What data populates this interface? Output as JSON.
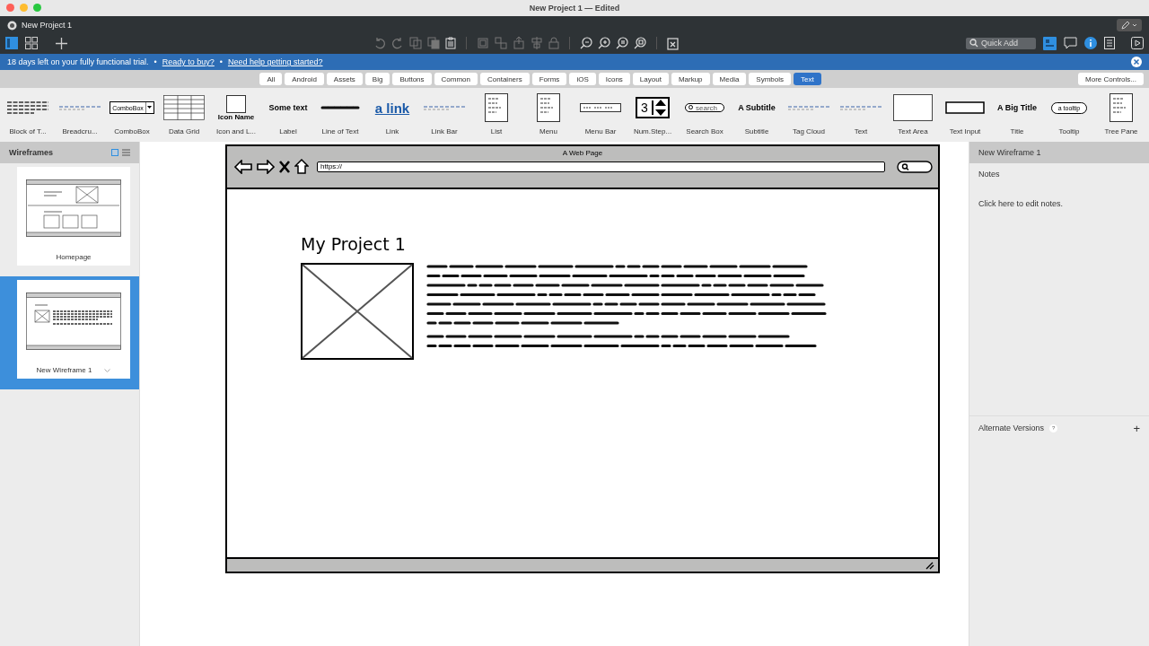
{
  "window": {
    "title": "New Project 1 — Edited"
  },
  "toolbar": {
    "project": "New Project 1",
    "quick_add": {
      "placeholder": "Quick Add"
    }
  },
  "trial_bar": {
    "message": "18 days left on your fully functional trial.",
    "separator": "•",
    "links": [
      "Ready to buy?",
      "Need help getting started?"
    ]
  },
  "filters": [
    {
      "label": "All",
      "selected": false
    },
    {
      "label": "Android",
      "selected": false
    },
    {
      "label": "Assets",
      "selected": false
    },
    {
      "label": "Big",
      "selected": false
    },
    {
      "label": "Buttons",
      "selected": false
    },
    {
      "label": "Common",
      "selected": false
    },
    {
      "label": "Containers",
      "selected": false
    },
    {
      "label": "Forms",
      "selected": false
    },
    {
      "label": "iOS",
      "selected": false
    },
    {
      "label": "Icons",
      "selected": false
    },
    {
      "label": "Layout",
      "selected": false
    },
    {
      "label": "Markup",
      "selected": false
    },
    {
      "label": "Media",
      "selected": false
    },
    {
      "label": "Symbols",
      "selected": false
    },
    {
      "label": "Text",
      "selected": true
    }
  ],
  "more_controls": "More Controls...",
  "library": [
    {
      "label": "Block of T...",
      "kind": "lines"
    },
    {
      "label": "Breadcru...",
      "kind": "thin"
    },
    {
      "label": "ComboBox",
      "kind": "combo",
      "preview": "ComboBox"
    },
    {
      "label": "Data Grid",
      "kind": "grid"
    },
    {
      "label": "Icon and L...",
      "kind": "icon",
      "preview": "Icon Name"
    },
    {
      "label": "Label",
      "kind": "label",
      "preview": "Some text"
    },
    {
      "label": "Line of Text",
      "kind": "scribble"
    },
    {
      "label": "Link",
      "kind": "link",
      "preview": "a link"
    },
    {
      "label": "Link Bar",
      "kind": "thin"
    },
    {
      "label": "List",
      "kind": "list"
    },
    {
      "label": "Menu",
      "kind": "list"
    },
    {
      "label": "Menu Bar",
      "kind": "menubar"
    },
    {
      "label": "Num.Step...",
      "kind": "stepper",
      "preview": "3"
    },
    {
      "label": "Search Box",
      "kind": "search",
      "preview": "search"
    },
    {
      "label": "Subtitle",
      "kind": "label",
      "preview": "A Subtitle"
    },
    {
      "label": "Tag Cloud",
      "kind": "thin"
    },
    {
      "label": "Text",
      "kind": "thin"
    },
    {
      "label": "Text Area",
      "kind": "box"
    },
    {
      "label": "Text Input",
      "kind": "input"
    },
    {
      "label": "Title",
      "kind": "label",
      "preview": "A Big Title"
    },
    {
      "label": "Tooltip",
      "kind": "tooltip",
      "preview": "a tooltip"
    },
    {
      "label": "Tree Pane",
      "kind": "list"
    }
  ],
  "sidebar": {
    "title": "Wireframes",
    "pages": [
      {
        "label": "Homepage",
        "selected": false
      },
      {
        "label": "New Wireframe 1",
        "selected": true
      }
    ]
  },
  "mockup": {
    "title": "A Web Page",
    "url": "https://",
    "heading": "My Project 1"
  },
  "inspector": {
    "title": "New Wireframe 1",
    "notes_label": "Notes",
    "notes_hint": "Click here to edit notes.",
    "versions_label": "Alternate Versions",
    "help": "?",
    "add": "+"
  }
}
